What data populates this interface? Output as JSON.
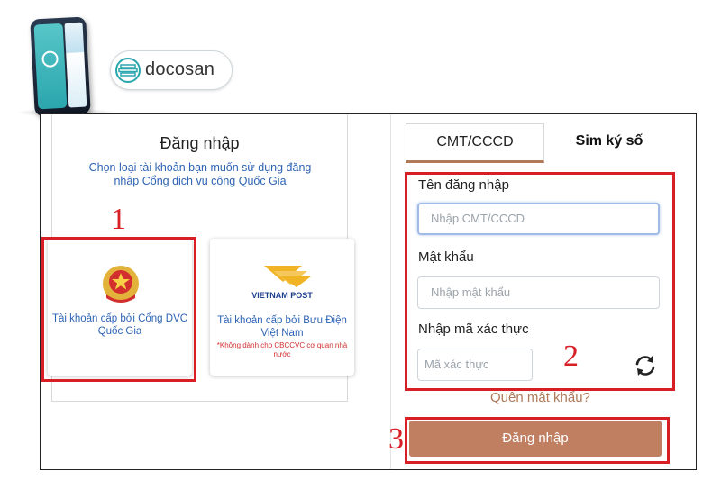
{
  "brand": {
    "name": "docosan"
  },
  "left": {
    "title": "Đăng nhập",
    "subtitle": "Chọn loại tài khoản bạn muốn sử dụng đăng nhập Cổng dịch vụ công Quốc Gia",
    "account1": {
      "label": "Tài khoản cấp bởi Cổng DVC Quốc Gia"
    },
    "account2": {
      "logo_text": "VIETNAM POST",
      "label": "Tài khoản cấp bởi Bưu Điện Việt Nam",
      "note": "*Không dành cho CBCCVC cơ quan nhà nước"
    }
  },
  "right": {
    "tabs": [
      "CMT/CCCD",
      "Sim ký số"
    ],
    "username_label": "Tên đăng nhập",
    "username_placeholder": "Nhập CMT/CCCD",
    "password_label": "Mật khẩu",
    "password_placeholder": "Nhập mật khẩu",
    "captcha_label": "Nhập mã xác thực",
    "captcha_placeholder": "Mã xác thực",
    "forgot": "Quên mật khẩu?",
    "login_button": "Đăng nhập"
  },
  "annotations": {
    "step1": "1",
    "step2": "2",
    "step3": "3"
  },
  "colors": {
    "accent": "#c17f62",
    "annotation": "#d81f26",
    "link": "#2d63b4"
  }
}
